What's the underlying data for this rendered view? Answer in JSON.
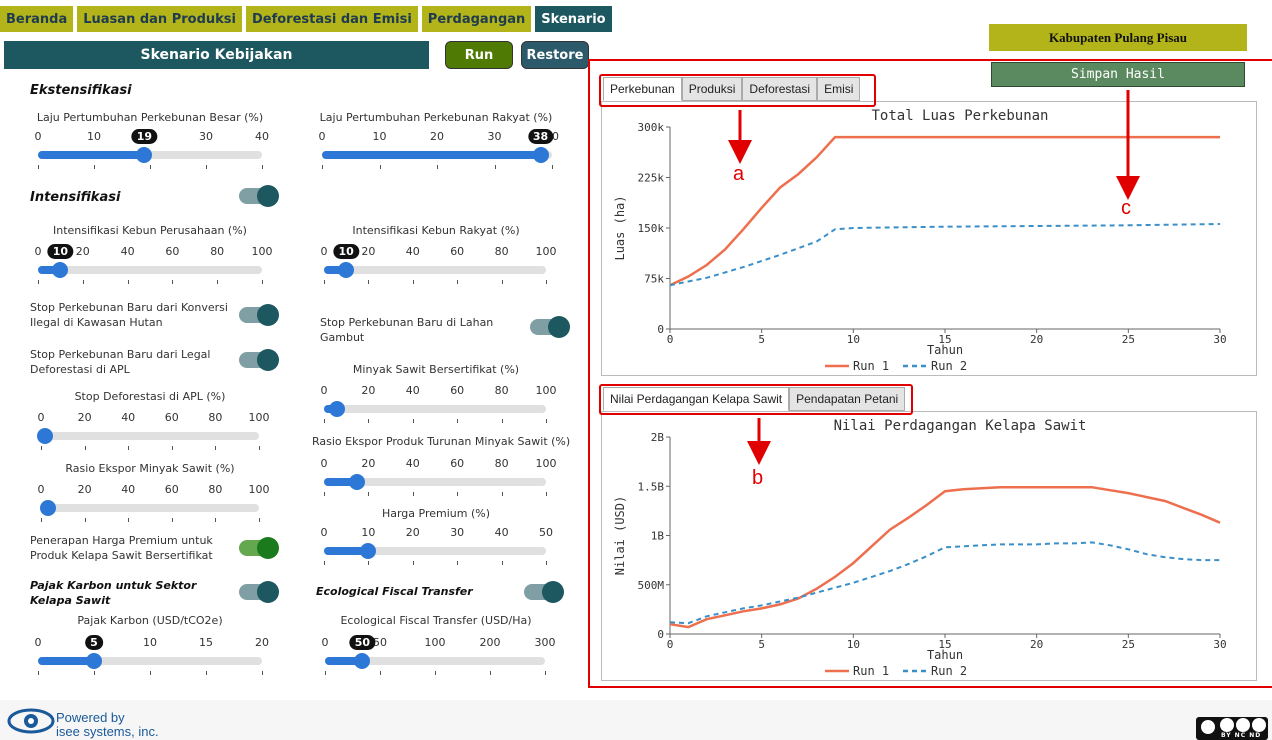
{
  "nav": {
    "tabs": [
      {
        "label": "Beranda"
      },
      {
        "label": "Luasan dan Produksi"
      },
      {
        "label": "Deforestasi dan Emisi"
      },
      {
        "label": "Perdagangan"
      },
      {
        "label": "Skenario"
      }
    ]
  },
  "panel": {
    "title": "Skenario Kebijakan",
    "run_label": "Run",
    "restore_label": "Restore"
  },
  "sections": {
    "ekstensifikasi": "Ekstensifikasi",
    "intensifikasi": "Intensifikasi",
    "pajak_karbon": "Pajak Karbon untuk Sektor Kelapa Sawit",
    "eft": "Ecological Fiscal Transfer"
  },
  "controls": {
    "laju_besar": {
      "label": "Laju Pertumbuhan Perkebunan Besar (%)",
      "ticks": [
        "0",
        "10",
        "20",
        "30",
        "40"
      ],
      "value": "19",
      "fraction": 0.475
    },
    "laju_rakyat": {
      "label": "Laju Pertumbuhan Perkebunan Rakyat (%)",
      "ticks": [
        "0",
        "10",
        "20",
        "30",
        "40"
      ],
      "value": "38",
      "fraction": 0.95
    },
    "int_perusahaan": {
      "label": "Intensifikasi Kebun Perusahaan (%)",
      "ticks": [
        "0",
        "20",
        "40",
        "60",
        "80",
        "100"
      ],
      "value": "10",
      "fraction": 0.1
    },
    "int_rakyat": {
      "label": "Intensifikasi Kebun Rakyat (%)",
      "ticks": [
        "0",
        "20",
        "40",
        "60",
        "80",
        "100"
      ],
      "value": "10",
      "fraction": 0.1
    },
    "stop_ilegal": {
      "label": "Stop Perkebunan Baru dari Konversi Ilegal di Kawasan Hutan",
      "on": true
    },
    "stop_gambut": {
      "label": "Stop Perkebunan Baru di Lahan Gambut",
      "on": true
    },
    "stop_legal": {
      "label": "Stop Perkebunan Baru dari Legal Deforestasi di APL",
      "on": true
    },
    "minyak_sertifikat": {
      "label": "Minyak Sawit Bersertifikat (%)",
      "ticks": [
        "0",
        "20",
        "40",
        "60",
        "80",
        "100"
      ],
      "fraction": 0.06
    },
    "stop_def_apl": {
      "label": "Stop Deforestasi di APL (%)",
      "ticks": [
        "0",
        "20",
        "40",
        "60",
        "80",
        "100"
      ],
      "fraction": 0.02
    },
    "rasio_turunan": {
      "label": "Rasio Ekspor Produk Turunan Minyak Sawit (%)",
      "ticks": [
        "0",
        "20",
        "40",
        "60",
        "80",
        "100"
      ],
      "fraction": 0.15
    },
    "rasio_minyak": {
      "label": "Rasio Ekspor Minyak Sawit (%)",
      "ticks": [
        "0",
        "20",
        "40",
        "60",
        "80",
        "100"
      ],
      "fraction": 0.03
    },
    "harga_premium": {
      "label": "Harga Premium (%)",
      "ticks": [
        "0",
        "10",
        "20",
        "30",
        "40",
        "50"
      ],
      "fraction": 0.2
    },
    "penerapan_premium": {
      "label": "Penerapan Harga Premium untuk Produk Kelapa Sawit Bersertifikat",
      "on": true
    },
    "pajak_karbon": {
      "label": "Pajak Karbon (USD/tCO2e)",
      "ticks": [
        "0",
        "5",
        "10",
        "15",
        "20"
      ],
      "value": "5",
      "fraction": 0.25
    },
    "eft": {
      "label": "Ecological Fiscal Transfer (USD/Ha)",
      "ticks": [
        "0",
        "50",
        "100",
        "200",
        "300"
      ],
      "value": "50",
      "fraction": 0.17
    }
  },
  "region": "Kabupaten Pulang Pisau",
  "save_label": "Simpan Hasil",
  "chart_tabs_top": [
    {
      "label": "Perkebunan"
    },
    {
      "label": "Produksi"
    },
    {
      "label": "Deforestasi"
    },
    {
      "label": "Emisi"
    }
  ],
  "chart_tabs_bottom": [
    {
      "label": "Nilai Perdagangan Kelapa Sawit"
    },
    {
      "label": "Pendapatan Petani"
    }
  ],
  "annotations": [
    "a",
    "b",
    "c"
  ],
  "footer": {
    "powered_1": "Powered by",
    "powered_2": "isee systems, inc.",
    "license_small": "BY NC ND"
  },
  "colors": {
    "run1": "#ee6f4e",
    "run2": "#3a8fc9",
    "accent_olive": "#b3b419",
    "teal": "#1d5760",
    "red_annotation": "#e00000"
  },
  "chart_data": [
    {
      "type": "line",
      "title": "Total Luas Perkebunan",
      "xlabel": "Tahun",
      "ylabel": "Luas (ha)",
      "xlim": [
        0,
        30
      ],
      "ylim": [
        0,
        300000
      ],
      "xticks": [
        0,
        5,
        10,
        15,
        20,
        25,
        30
      ],
      "yticks": [
        0,
        75000,
        150000,
        225000,
        300000
      ],
      "ytick_labels": [
        "0",
        "75k",
        "150k",
        "225k",
        "300k"
      ],
      "legend": "bottom",
      "series": [
        {
          "name": "Run 1",
          "style": "solid",
          "x": [
            0,
            1,
            2,
            3,
            4,
            5,
            6,
            7,
            8,
            9,
            10,
            15,
            20,
            25,
            30
          ],
          "y": [
            65000,
            78000,
            95000,
            118000,
            148000,
            180000,
            210000,
            230000,
            255000,
            285000,
            285000,
            285000,
            285000,
            285000,
            285000
          ]
        },
        {
          "name": "Run 2",
          "style": "dashed",
          "x": [
            0,
            2,
            4,
            6,
            8,
            9,
            10,
            15,
            20,
            25,
            30
          ],
          "y": [
            65000,
            76000,
            92000,
            110000,
            130000,
            148000,
            150000,
            152000,
            153000,
            154000,
            156000
          ]
        }
      ]
    },
    {
      "type": "line",
      "title": "Nilai Perdagangan Kelapa Sawit",
      "xlabel": "Tahun",
      "ylabel": "Nilai (USD)",
      "xlim": [
        0,
        30
      ],
      "ylim": [
        0,
        2000000000
      ],
      "xticks": [
        0,
        5,
        10,
        15,
        20,
        25,
        30
      ],
      "yticks": [
        0,
        500000000,
        1000000000,
        1500000000,
        2000000000
      ],
      "ytick_labels": [
        "0",
        "500M",
        "1B",
        "1.5B",
        "2B"
      ],
      "legend": "bottom",
      "series": [
        {
          "name": "Run 1",
          "style": "solid",
          "x": [
            0,
            1,
            2,
            3,
            4,
            5,
            6,
            7,
            8,
            9,
            10,
            11,
            12,
            13,
            14,
            15,
            16,
            17,
            18,
            19,
            20,
            21,
            22,
            23,
            24,
            25,
            26,
            27,
            28,
            29,
            30
          ],
          "y": [
            100000000,
            70000000,
            150000000,
            190000000,
            230000000,
            260000000,
            300000000,
            360000000,
            460000000,
            580000000,
            720000000,
            890000000,
            1060000000,
            1180000000,
            1310000000,
            1450000000,
            1470000000,
            1480000000,
            1490000000,
            1490000000,
            1490000000,
            1490000000,
            1490000000,
            1490000000,
            1460000000,
            1430000000,
            1390000000,
            1350000000,
            1280000000,
            1210000000,
            1130000000
          ]
        },
        {
          "name": "Run 2",
          "style": "dashed",
          "x": [
            0,
            1,
            2,
            3,
            4,
            5,
            6,
            7,
            8,
            9,
            10,
            11,
            12,
            13,
            14,
            15,
            16,
            17,
            18,
            19,
            20,
            21,
            22,
            23,
            24,
            25,
            26,
            27,
            28,
            29,
            30
          ],
          "y": [
            120000000,
            110000000,
            180000000,
            220000000,
            260000000,
            290000000,
            330000000,
            370000000,
            420000000,
            470000000,
            520000000,
            580000000,
            640000000,
            710000000,
            790000000,
            880000000,
            890000000,
            900000000,
            910000000,
            910000000,
            910000000,
            920000000,
            920000000,
            930000000,
            900000000,
            860000000,
            810000000,
            780000000,
            760000000,
            750000000,
            750000000
          ]
        }
      ]
    }
  ]
}
